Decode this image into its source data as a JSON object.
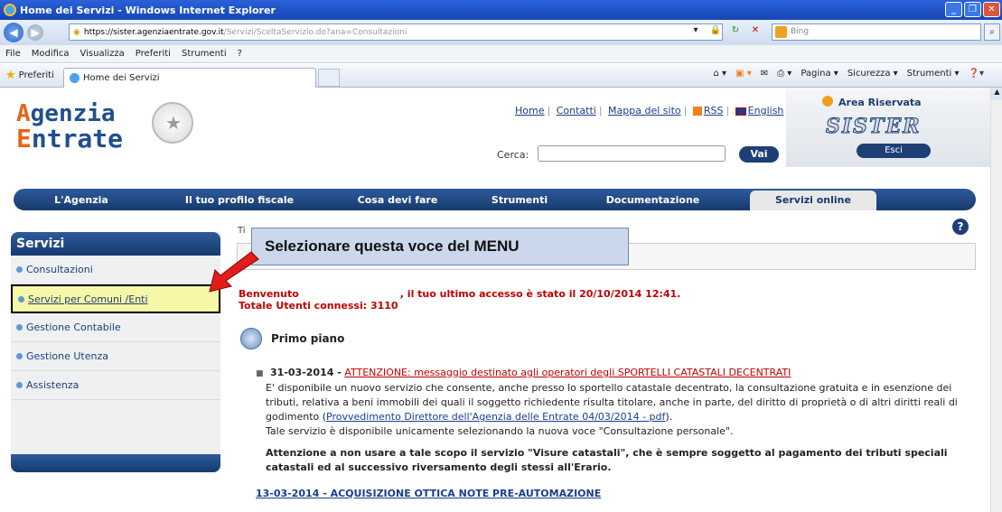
{
  "window": {
    "title": "Home dei Servizi - Windows Internet Explorer"
  },
  "addressbar": {
    "url_host": "https://sister.agenziaentrate.gov.it",
    "url_path": "/Servizi/SceltaServizio.do?ana=Consultazioni",
    "search_placeholder": "Bing"
  },
  "menubar": {
    "items": [
      "File",
      "Modifica",
      "Visualizza",
      "Preferiti",
      "Strumenti",
      "?"
    ]
  },
  "tabrow": {
    "favorites": "Preferiti",
    "tab_title": "Home dei Servizi",
    "commands": [
      "Pagina ▾",
      "Sicurezza ▾",
      "Strumenti ▾"
    ]
  },
  "header": {
    "logo_line1": "genzia",
    "logo_line2": "ntrate",
    "logo_initial": "A",
    "logo_initial2": "E",
    "links": [
      "Home",
      "Contatti",
      "Mappa del sito",
      "RSS",
      "English"
    ],
    "search_label": "Cerca:",
    "search_button": "Vai",
    "area_riservata": "Area Riservata",
    "sister": "SISTER",
    "esci": "Esci"
  },
  "mainnav": {
    "items": [
      "L'Agenzia",
      "Il tuo profilo fiscale",
      "Cosa devi fare",
      "Strumenti",
      "Documentazione",
      "Servizi online"
    ]
  },
  "sidebar": {
    "title": "Servizi",
    "items": [
      "Consultazioni",
      "Servizi per Comuni /Enti",
      "Gestione Contabile",
      "Gestione Utenza",
      "Assistenza"
    ]
  },
  "callout": {
    "text": "Selezionare questa  voce del MENU"
  },
  "content": {
    "title_stub": "Ti",
    "welcome_prefix": "Benvenuto",
    "welcome_suffix": ", il tuo ultimo accesso è stato il 20/10/2014 12:41.",
    "total_users": "Totale Utenti connessi: 3110",
    "section_title": "Primo piano",
    "news1_date": "31-03-2014 -",
    "news1_title": "ATTENZIONE: messaggio destinato agli operatori degli SPORTELLI CATASTALI DECENTRATI",
    "news1_body_a": "E' disponibile un nuovo servizio che consente, anche presso lo sportello catastale decentrato, la consultazione gratuita e in esenzione dei tributi, relativa a beni immobili dei quali il soggetto richiedente risulta titolare, anche in parte, del diritto di proprietà o di altri diritti reali di godimento (",
    "news1_link": "Provvedimento Direttore dell'Agenzia delle Entrate 04/03/2014 - pdf",
    "news1_body_b": ").",
    "news1_body_c": "Tale servizio è disponibile unicamente selezionando la nuova voce \"Consultazione personale\".",
    "news1_attention": "Attenzione a non usare a tale scopo il servizio \"Visure catastali\", che è sempre soggetto al pagamento dei tributi speciali catastali ed al successivo riversamento degli stessi all'Erario.",
    "news2": "13-03-2014 - ACQUISIZIONE OTTICA NOTE PRE-AUTOMAZIONE"
  },
  "colors": {
    "brand_blue": "#1e3f75",
    "accent_orange": "#e3661c",
    "alert_red": "#c00000"
  }
}
